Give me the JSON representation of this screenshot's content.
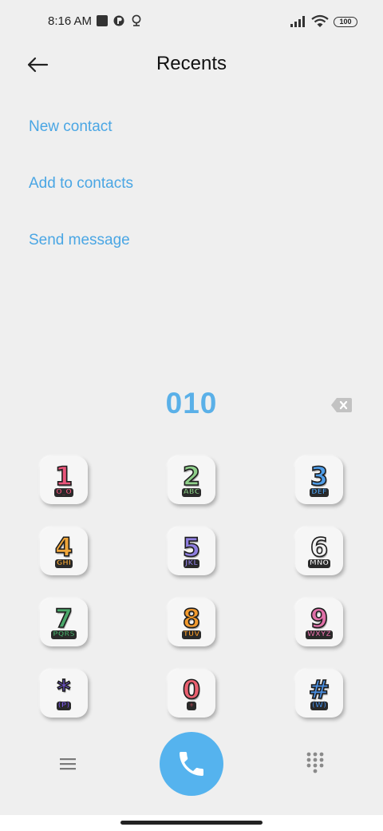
{
  "status_bar": {
    "time": "8:16 AM",
    "battery": "100",
    "icons": [
      "notification-square-icon",
      "app-icon",
      "location-pin-icon",
      "signal-icon",
      "wifi-icon",
      "battery-icon"
    ]
  },
  "header": {
    "title": "Recents",
    "back_icon": "arrow-left-icon"
  },
  "actions": {
    "new_contact": "New contact",
    "add_to_contacts": "Add to contacts",
    "send_message": "Send message"
  },
  "dial": {
    "number": "010",
    "backspace_icon": "backspace-icon"
  },
  "keypad": [
    {
      "digit": "1",
      "letters": "O_O",
      "color": "#e8557a"
    },
    {
      "digit": "2",
      "letters": "ABC",
      "color": "#8fcf8a"
    },
    {
      "digit": "3",
      "letters": "DEF",
      "color": "#4f9de8"
    },
    {
      "digit": "4",
      "letters": "GHI",
      "color": "#f0a63a"
    },
    {
      "digit": "5",
      "letters": "JKL",
      "color": "#8f7fe0"
    },
    {
      "digit": "6",
      "letters": "MNO",
      "color": "#f2f2f2"
    },
    {
      "digit": "7",
      "letters": "PQRS",
      "color": "#4aa86a"
    },
    {
      "digit": "8",
      "letters": "TUV",
      "color": "#f29a2e"
    },
    {
      "digit": "9",
      "letters": "WXYZ",
      "color": "#e070a8"
    },
    {
      "digit": "*",
      "letters": "(P)",
      "color": "#7a5ae0"
    },
    {
      "digit": "0",
      "letters": "+",
      "color": "#ea6070"
    },
    {
      "digit": "#",
      "letters": "(W)",
      "color": "#4a8ee0"
    }
  ],
  "bottom_bar": {
    "menu_icon": "hamburger-menu-icon",
    "call_icon": "phone-icon",
    "dialpad_icon": "dialpad-grid-icon"
  },
  "colors": {
    "accent": "#4aa6e4",
    "number": "#5ab0e8",
    "call_button": "#55b3ee",
    "background": "#efefef"
  }
}
